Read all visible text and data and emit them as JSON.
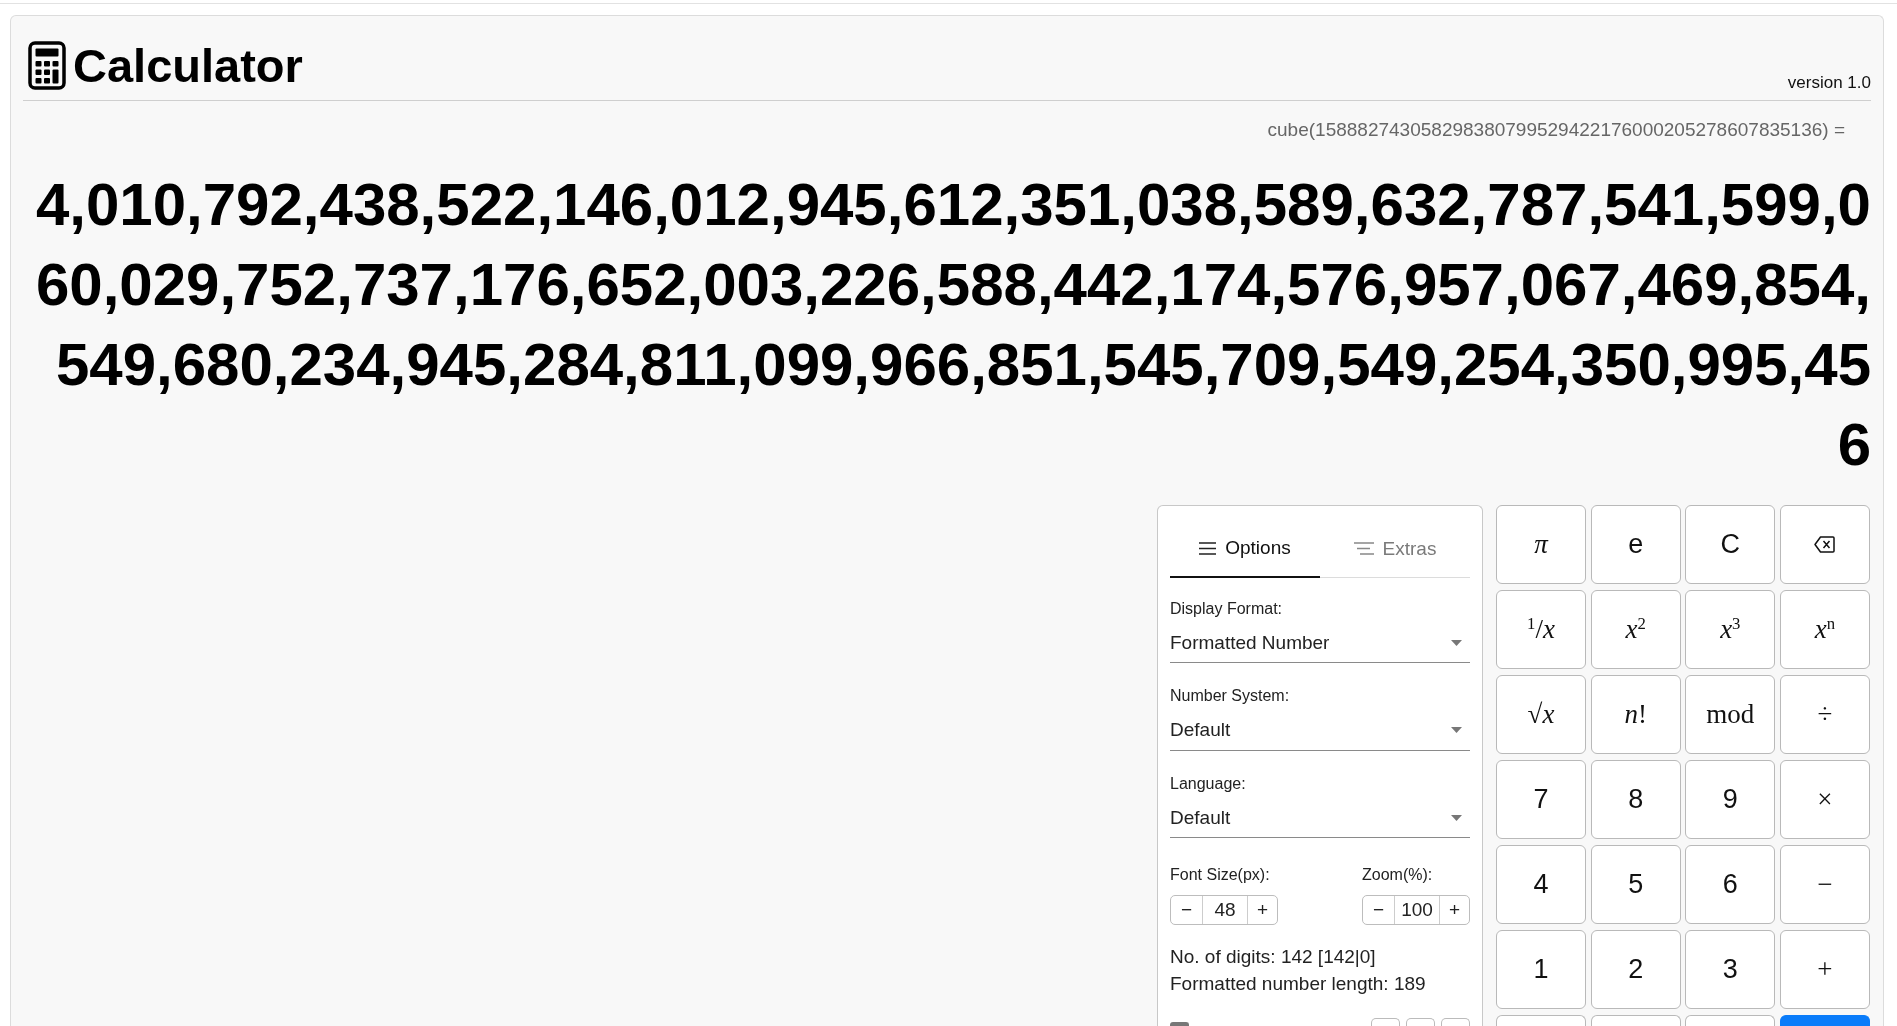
{
  "header": {
    "title": "Calculator",
    "version": "version 1.0"
  },
  "display": {
    "expression": "cube(158882743058298380799529422176000205278607835136) =",
    "result": "4,010,792,438,522,146,012,945,612,351,038,589,632,787,541,599,060,029,752,737,176,652,003,226,588,442,174,576,957,067,469,854,549,680,234,945,284,811,099,966,851,545,709,549,254,350,995,456"
  },
  "options": {
    "tabs": [
      {
        "label": "Options",
        "selected": true
      },
      {
        "label": "Extras",
        "selected": false
      }
    ],
    "selects": [
      {
        "label": "Display Format:",
        "value": "Formatted Number"
      },
      {
        "label": "Number System:",
        "value": "Default"
      },
      {
        "label": "Language:",
        "value": "Default"
      }
    ],
    "steppers": [
      {
        "label": "Font Size(px):",
        "value": "48",
        "minus": "−",
        "plus": "+"
      },
      {
        "label": "Zoom(%):",
        "value": "100",
        "minus": "−",
        "plus": "+"
      }
    ],
    "stats": [
      "No. of digits: 142 [142|0]",
      "Formatted number length: 189"
    ],
    "checkbox": {
      "checked": true
    },
    "small_buttons": [
      {
        "kind": "button"
      },
      {
        "kind": "button"
      },
      {
        "kind": "button"
      }
    ]
  },
  "keypad": [
    {
      "kind": "math",
      "label": "*π*"
    },
    {
      "kind": "text",
      "label": "e"
    },
    {
      "kind": "text",
      "label": "C"
    },
    {
      "kind": "backspace"
    },
    {
      "kind": "math",
      "label": "$^{1}$/*x*"
    },
    {
      "kind": "math",
      "label": "*x*$^{2}$"
    },
    {
      "kind": "math",
      "label": "*x*$^{3}$"
    },
    {
      "kind": "math",
      "label": "*x*$^{n}$"
    },
    {
      "kind": "math",
      "label": "√*x*"
    },
    {
      "kind": "math",
      "label": "*n*!"
    },
    {
      "kind": "math",
      "label": "mod"
    },
    {
      "kind": "math",
      "label": "÷"
    },
    {
      "kind": "text",
      "label": "7"
    },
    {
      "kind": "text",
      "label": "8"
    },
    {
      "kind": "text",
      "label": "9"
    },
    {
      "kind": "math",
      "label": "×"
    },
    {
      "kind": "text",
      "label": "4"
    },
    {
      "kind": "text",
      "label": "5"
    },
    {
      "kind": "text",
      "label": "6"
    },
    {
      "kind": "math",
      "label": "−"
    },
    {
      "kind": "text",
      "label": "1"
    },
    {
      "kind": "text",
      "label": "2"
    },
    {
      "kind": "text",
      "label": "3"
    },
    {
      "kind": "math",
      "label": "+"
    },
    {
      "kind": "partial"
    },
    {
      "kind": "partial"
    },
    {
      "kind": "partial"
    },
    {
      "kind": "partial_primary"
    }
  ]
}
